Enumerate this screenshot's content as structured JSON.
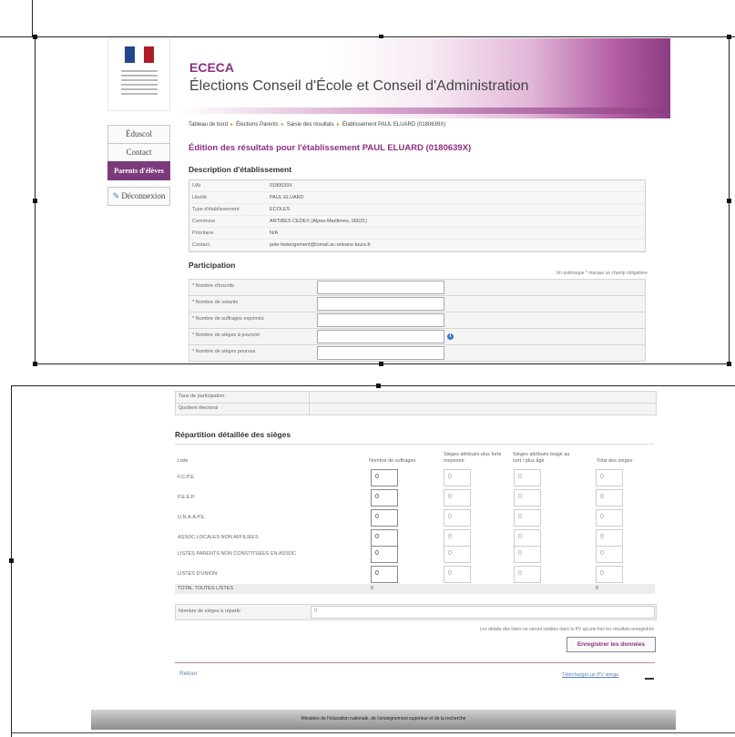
{
  "header": {
    "app_short": "ECECA",
    "app_full": "Élections Conseil d'École et Conseil d'Administration",
    "flag_colors": [
      "#21468b",
      "#ffffff",
      "#ae1c28"
    ]
  },
  "nav": {
    "eduscol": "Éduscol",
    "contact": "Contact",
    "parents": "Parents d'élèves",
    "logout": "Déconnexion"
  },
  "breadcrumb": [
    "Tableau de bord",
    "Élections Parents",
    "Saisie des résultats",
    "Établissement PAUL ELUARD (0180639X)"
  ],
  "page_title": "Édition des résultats pour l'établissement PAUL ELUARD (0180639X)",
  "description": {
    "title": "Description d'établissement",
    "rows": [
      {
        "k": "UAI",
        "v": "0180639X"
      },
      {
        "k": "Libellé",
        "v": "PAUL ELUARD"
      },
      {
        "k": "Type d'établissement",
        "v": "ECOLES"
      },
      {
        "k": "Commune",
        "v": "ANTIBES CEDEX (Alpes-Maritimes, 06631)"
      },
      {
        "k": "Prioritaire",
        "v": "N/A"
      },
      {
        "k": "Contact",
        "v": "pole-hebergement@lomail.ac-orleans-tours.fr"
      }
    ]
  },
  "participation": {
    "title": "Participation",
    "required_note": "Un astérisque * marque un champ obligatoire",
    "fields": [
      "* Nombre d'inscrits",
      "* Nombre de votants",
      "* Nombre de suffrages exprimés",
      "* Nombre de sièges à pourvoir",
      "* Nombre de sièges pourvus"
    ]
  },
  "results": {
    "rate_label": "Taux de participation",
    "quotient_label": "Quotient électoral"
  },
  "repartition": {
    "title": "Répartition détaillée des sièges",
    "headers": {
      "liste": "Liste",
      "suffrages": "Nombre de suffrages",
      "forte": "Sièges attribués plus forte moyenne",
      "sort": "Sièges attribués tirage au sort / plus âgé",
      "total": "Total des sièges"
    },
    "lists": [
      {
        "name": "F.C.P.E.",
        "values": [
          "0",
          "0",
          "0",
          "0"
        ]
      },
      {
        "name": "P.E.E.P.",
        "values": [
          "0",
          "0",
          "0",
          "0"
        ]
      },
      {
        "name": "U.N.A.A.P.E.",
        "values": [
          "0",
          "0",
          "0",
          "0"
        ]
      },
      {
        "name": "ASSOC LOCALES NON AFFILIEES",
        "values": [
          "0",
          "0",
          "0",
          "0"
        ]
      },
      {
        "name": "LISTES PARENTS NON CONSTITUEES EN ASSOC",
        "values": [
          "0",
          "0",
          "0",
          "0"
        ]
      },
      {
        "name": "LISTES D'UNION",
        "values": [
          "0",
          "0",
          "0",
          "0"
        ]
      }
    ],
    "totals": {
      "label": "TOTAL TOUTES LISTES",
      "suffrages": "0",
      "total": "0"
    }
  },
  "seats_to_distribute": {
    "label": "Nombre de sièges à répartir",
    "value": "0"
  },
  "note_bottom": "Les détails des listes ne seront visibles dans le PV qu'une fois les résultats enregistrés",
  "save_button": "Enregistrer les données",
  "back_link": "Retour",
  "download_link": "Télécharger un PV vierge",
  "footer": "Ministère de l'éducation nationale, de l'enseignement supérieur et de la recherche"
}
